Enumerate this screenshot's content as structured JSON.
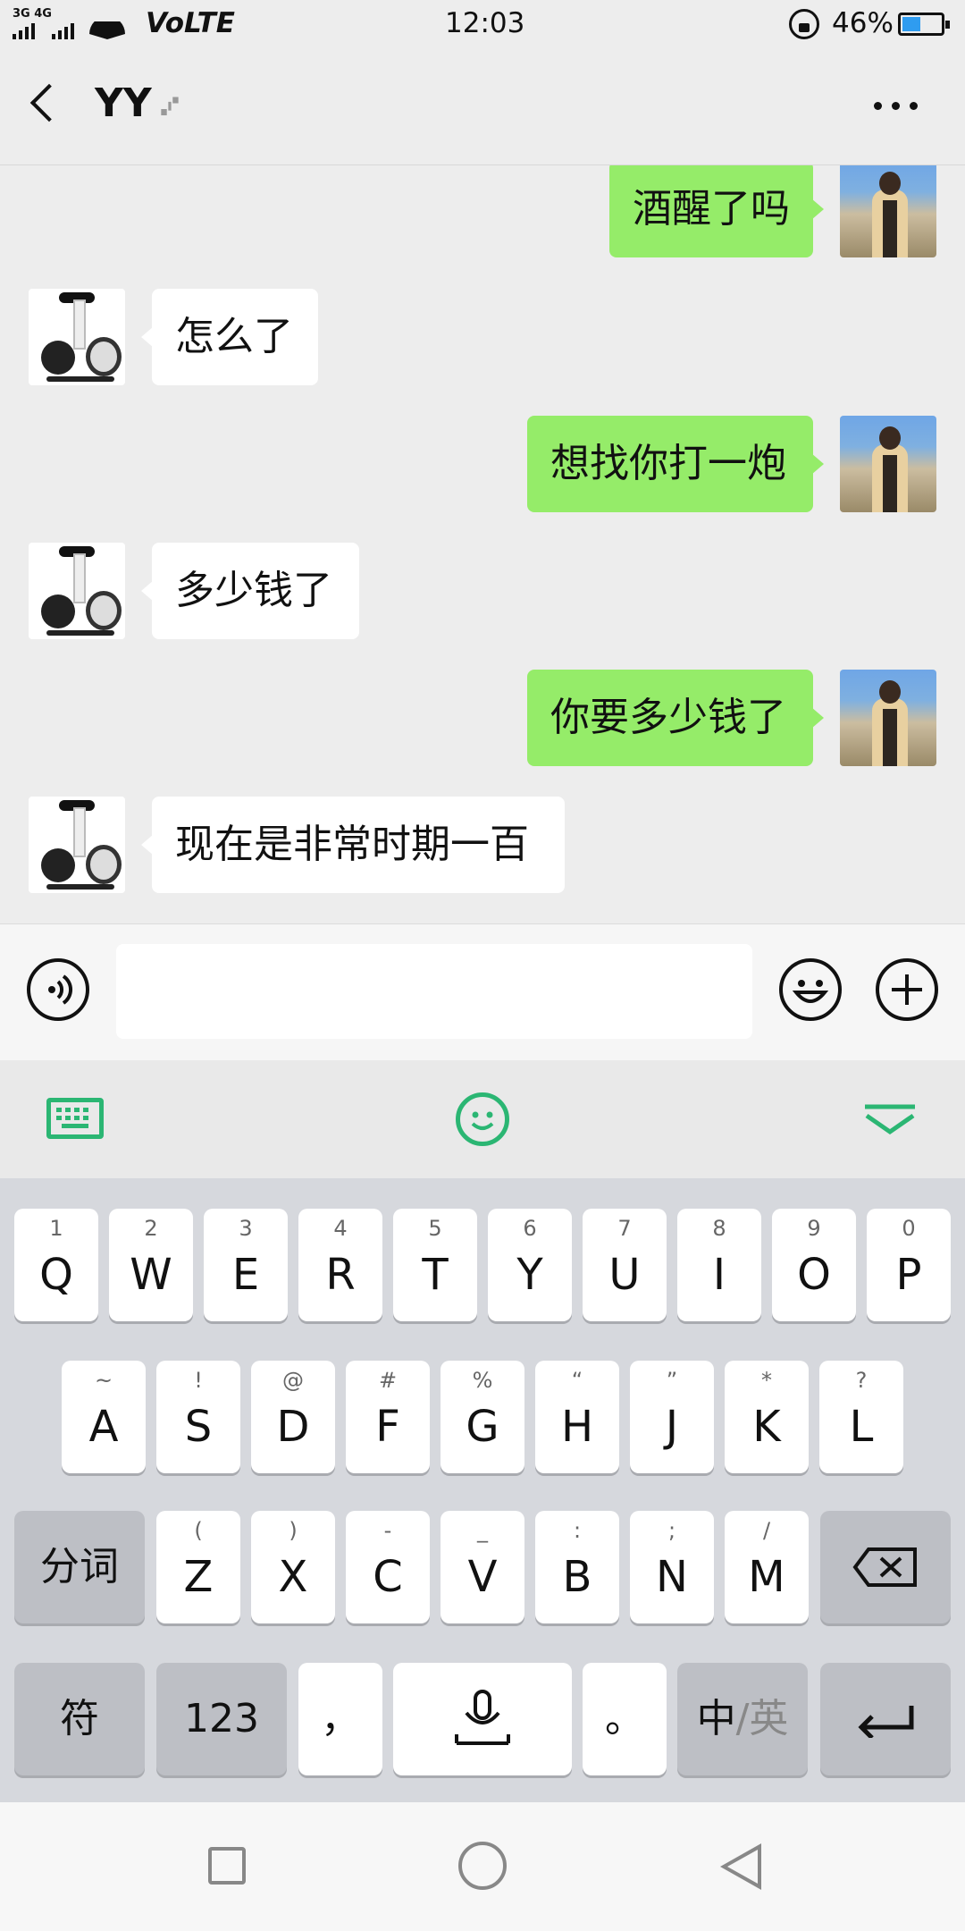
{
  "status_bar": {
    "signal": "3G 4G",
    "volte": "VoLTE",
    "time": "12:03",
    "battery_percent": "46%",
    "battery_level": 0.46
  },
  "header": {
    "title": "YY",
    "back_icon": "back-arrow-icon",
    "ear_icon": "ear-icon",
    "more_icon": "more-icon"
  },
  "messages": [
    {
      "from": "me",
      "text": "酒醒了吗"
    },
    {
      "from": "them",
      "text": "怎么了"
    },
    {
      "from": "me",
      "text": "想找你打一炮"
    },
    {
      "from": "them",
      "text": "多少钱了"
    },
    {
      "from": "me",
      "text": "你要多少钱了"
    },
    {
      "from": "them",
      "text": "现在是非常时期一百"
    }
  ],
  "input": {
    "value": "",
    "voice_icon": "voice-icon",
    "emoji_icon": "emoji-icon",
    "plus_icon": "plus-icon"
  },
  "keyboard": {
    "row1": [
      {
        "hint": "1",
        "label": "Q"
      },
      {
        "hint": "2",
        "label": "W"
      },
      {
        "hint": "3",
        "label": "E"
      },
      {
        "hint": "4",
        "label": "R"
      },
      {
        "hint": "5",
        "label": "T"
      },
      {
        "hint": "6",
        "label": "Y"
      },
      {
        "hint": "7",
        "label": "U"
      },
      {
        "hint": "8",
        "label": "I"
      },
      {
        "hint": "9",
        "label": "O"
      },
      {
        "hint": "0",
        "label": "P"
      }
    ],
    "row2": [
      {
        "hint": "~",
        "label": "A"
      },
      {
        "hint": "!",
        "label": "S"
      },
      {
        "hint": "@",
        "label": "D"
      },
      {
        "hint": "#",
        "label": "F"
      },
      {
        "hint": "%",
        "label": "G"
      },
      {
        "hint": "“",
        "label": "H"
      },
      {
        "hint": "”",
        "label": "J"
      },
      {
        "hint": "*",
        "label": "K"
      },
      {
        "hint": "?",
        "label": "L"
      }
    ],
    "row3": [
      {
        "hint": "(",
        "label": "Z"
      },
      {
        "hint": ")",
        "label": "X"
      },
      {
        "hint": "-",
        "label": "C"
      },
      {
        "hint": "_",
        "label": "V"
      },
      {
        "hint": ":",
        "label": "B"
      },
      {
        "hint": ";",
        "label": "N"
      },
      {
        "hint": "/",
        "label": "M"
      }
    ],
    "segment": "分词",
    "symbols": "符",
    "numbers": "123",
    "comma": "，",
    "period": "。",
    "lang_zh": "中",
    "lang_sep": "/",
    "lang_en": "英"
  }
}
